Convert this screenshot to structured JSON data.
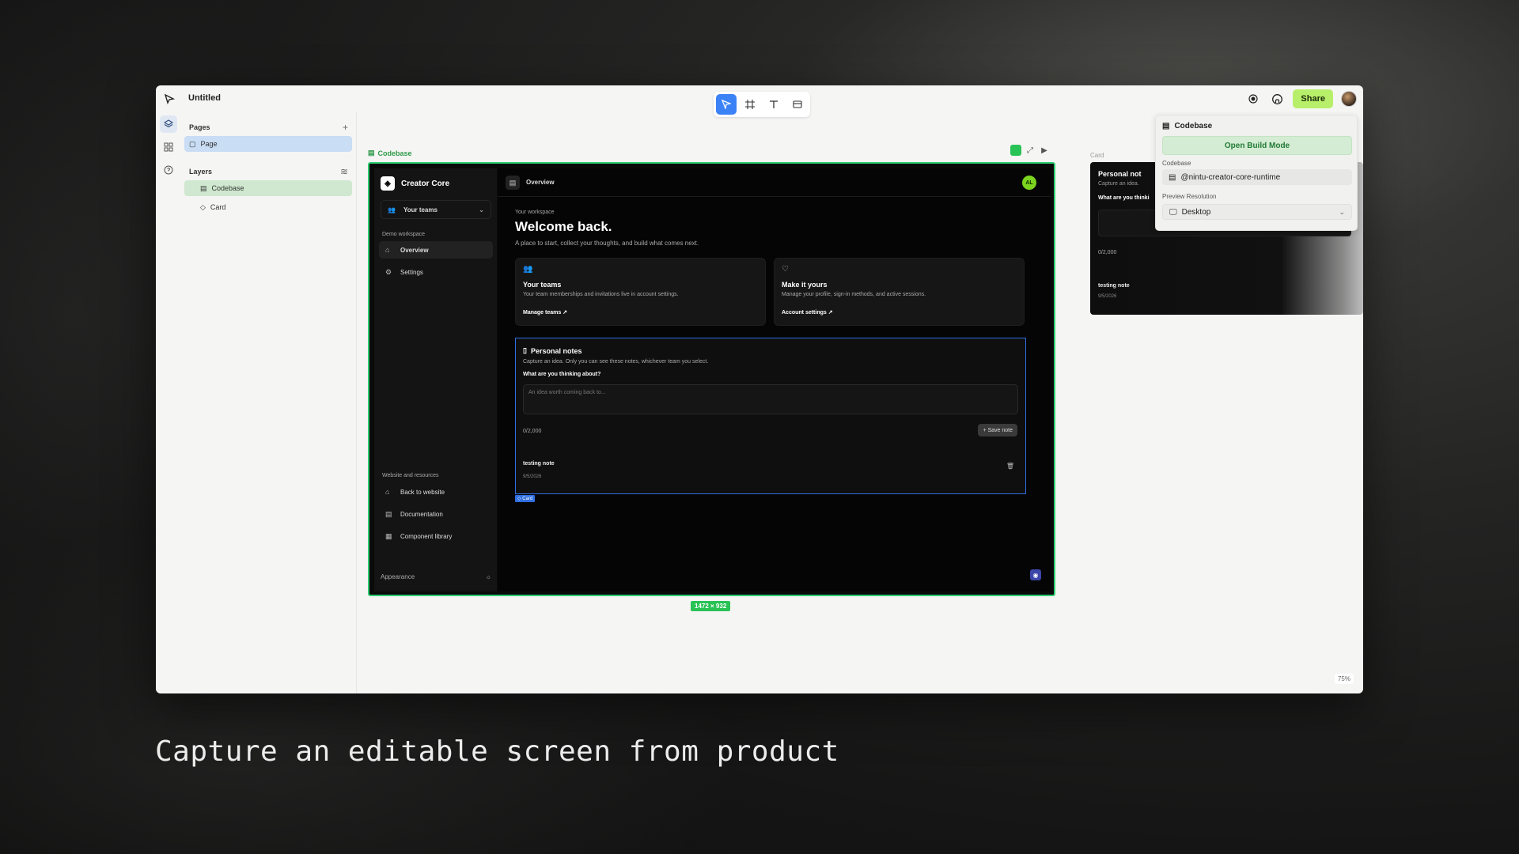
{
  "window": {
    "title": "Untitled",
    "toolbar": [
      {
        "name": "select-tool",
        "icon": "cursor-icon",
        "glyph": "⬀",
        "active": true
      },
      {
        "name": "frame-tool",
        "icon": "frame-icon",
        "glyph": "#",
        "active": false
      },
      {
        "name": "text-tool",
        "icon": "text-icon",
        "glyph": "T",
        "active": false
      },
      {
        "name": "component-tool",
        "icon": "component-icon",
        "glyph": "▭",
        "active": false
      }
    ],
    "share_label": "Share",
    "zoom": "75%"
  },
  "left_panel": {
    "pages_title": "Pages",
    "pages_add": "+",
    "page_item": "Page",
    "layers_title": "Layers",
    "layers": [
      {
        "label": "Codebase",
        "icon": "▤"
      },
      {
        "label": "Card",
        "icon": "◇"
      }
    ]
  },
  "canvas": {
    "frame_label": "Codebase",
    "size_badge": "1472 × 932",
    "ghost_label": "Card"
  },
  "app": {
    "brand": "Creator Core",
    "team_select": "Your teams",
    "nav_group_label": "Demo workspace",
    "nav_items": [
      {
        "label": "Overview",
        "icon": "⌂"
      },
      {
        "label": "Settings",
        "icon": "⚙"
      }
    ],
    "resources_label": "Website and resources",
    "resource_items": [
      {
        "label": "Back to website",
        "icon": "⌂"
      },
      {
        "label": "Documentation",
        "icon": "▤"
      },
      {
        "label": "Component library",
        "icon": "▦"
      }
    ],
    "appearance": "Appearance",
    "header_title": "Overview",
    "avatar_initials": "AL",
    "workspace_sub": "Your workspace",
    "welcome": "Welcome back.",
    "welcome_desc": "A place to start, collect your thoughts, and build what comes next.",
    "cards": [
      {
        "title": "Your teams",
        "desc": "Your team memberships and invitations live in account settings.",
        "link": "Manage teams ↗",
        "icon": "👥"
      },
      {
        "title": "Make it yours",
        "desc": "Manage your profile, sign-in methods, and active sessions.",
        "link": "Account settings ↗",
        "icon": "♡"
      }
    ],
    "notes": {
      "title": "Personal notes",
      "desc": "Capture an idea. Only you can see these notes, whichever team you select.",
      "question": "What are you thinking about?",
      "placeholder": "An idea worth coming back to...",
      "count": "0/2,000",
      "save": "+ Save note",
      "note_title": "testing note",
      "note_date": "9/5/2026",
      "tag": "◇ Card"
    }
  },
  "ghost": {
    "title": "Personal not",
    "desc": "Capture an idea.",
    "question": "What are you thinki",
    "count": "0/2,000",
    "note_title": "testing note",
    "note_date": "9/5/2026"
  },
  "props": {
    "title": "Codebase",
    "build_button": "Open Build Mode",
    "codebase_label": "Codebase",
    "codebase_value": "@nintu-creator-core-runtime",
    "resolution_label": "Preview Resolution",
    "resolution_value": "Desktop"
  },
  "caption": "Capture an editable screen from product"
}
